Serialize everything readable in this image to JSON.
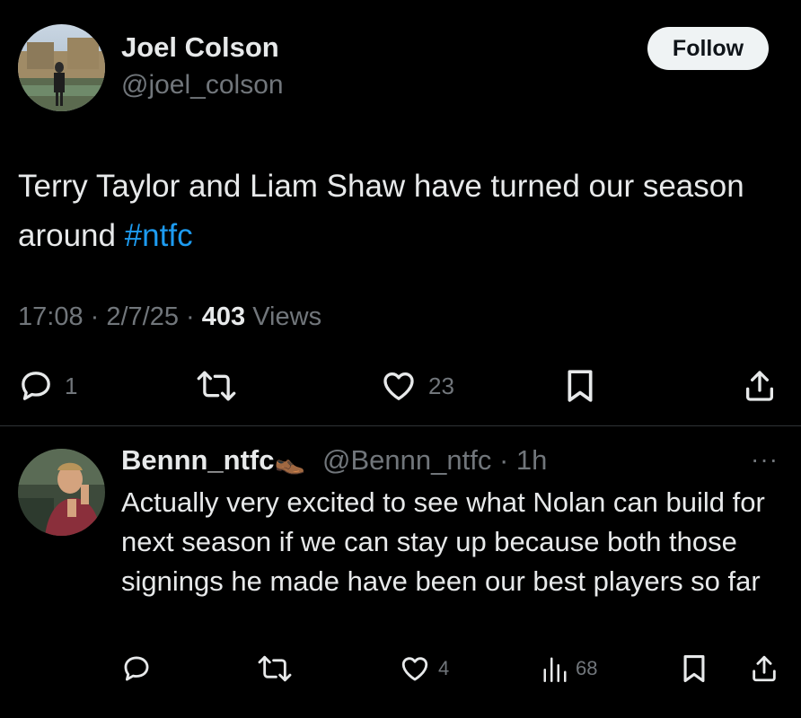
{
  "tweet": {
    "author_name": "Joel Colson",
    "author_handle": "@joel_colson",
    "follow_label": "Follow",
    "text_main": "Terry Taylor and Liam Shaw have turned our season around ",
    "hashtag": "#ntfc",
    "time": "17:08",
    "date": "2/7/25",
    "views_count": "403",
    "views_label": "Views",
    "stats": {
      "replies": "1",
      "likes": "23"
    },
    "icons": [
      "reply-icon",
      "retweet-icon",
      "like-icon",
      "bookmark-icon",
      "share-icon"
    ]
  },
  "reply": {
    "author_name": "Bennn_ntfc",
    "author_emoji": "👞",
    "author_handle": "@Bennn_ntfc",
    "age": "1h",
    "more": "···",
    "text": "Actually very excited to see what Nolan can build for next season if we can stay up because both those signings he made have been our best players so far",
    "stats": {
      "likes": "4",
      "views": "68"
    },
    "icons": [
      "reply-icon",
      "retweet-icon",
      "like-icon",
      "views-icon",
      "bookmark-icon",
      "share-icon"
    ]
  },
  "colors": {
    "background": "#000000",
    "text": "#e7e9ea",
    "muted": "#71767b",
    "link": "#1d9bf0",
    "button_bg": "#eff3f4"
  }
}
